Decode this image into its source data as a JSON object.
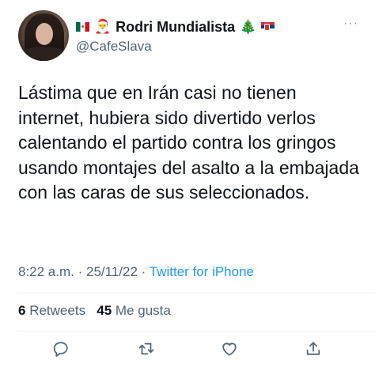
{
  "author": {
    "display_name": "Rodri Mundialista",
    "handle": "@CafeSlava",
    "flag_left": "mexico-flag",
    "flag_right": "serbia-flag",
    "emoji_santa": "🎅",
    "emoji_tree": "🎄"
  },
  "more_icon": "···",
  "tweet": {
    "text": "Lástima que en Irán casi no tienen internet, hubiera sido divertido verlos calentando el partido contra los gringos usando montajes del asalto a la embajada con las caras de sus seleccionados."
  },
  "meta": {
    "time": "8:22 a.m.",
    "separator": " · ",
    "date": "25/11/22",
    "source": "Twitter for iPhone"
  },
  "stats": {
    "retweets_count": "6",
    "retweets_label": "Retweets",
    "likes_count": "45",
    "likes_label": "Me gusta"
  },
  "actions": [
    "reply-icon",
    "retweet-icon",
    "like-icon",
    "share-icon"
  ],
  "colors": {
    "link": "#1d9bf0",
    "secondary_text": "#536471",
    "primary_text": "#0f1419",
    "icon": "#536471"
  }
}
